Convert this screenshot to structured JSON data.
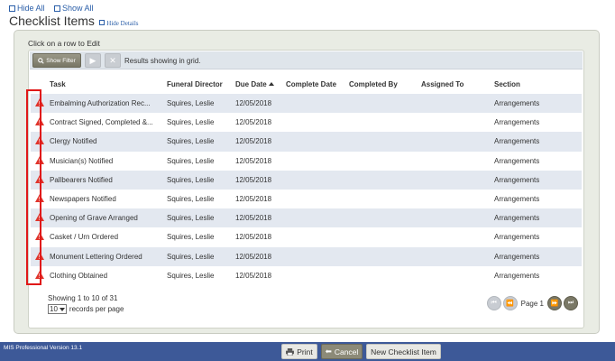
{
  "top_links": {
    "hide_all": "Hide All",
    "show_all": "Show All"
  },
  "header": {
    "title": "Checklist Items",
    "hide_details": "Hide Details"
  },
  "instruction": "Click on a row to Edit",
  "toolbar": {
    "show_filter": "Show Filter",
    "info": "Results showing in grid."
  },
  "columns": {
    "task": "Task",
    "director": "Funeral Director",
    "due": "Due Date",
    "complete": "Complete Date",
    "completed_by": "Completed By",
    "assigned": "Assigned To",
    "section": "Section"
  },
  "rows": [
    {
      "task": "Embalming Authorization Rec...",
      "director": "Squires, Leslie",
      "due": "12/05/2018",
      "section": "Arrangements"
    },
    {
      "task": "Contract Signed, Completed &...",
      "director": "Squires, Leslie",
      "due": "12/05/2018",
      "section": "Arrangements"
    },
    {
      "task": "Clergy Notified",
      "director": "Squires, Leslie",
      "due": "12/05/2018",
      "section": "Arrangements"
    },
    {
      "task": "Musician(s) Notified",
      "director": "Squires, Leslie",
      "due": "12/05/2018",
      "section": "Arrangements"
    },
    {
      "task": "Pallbearers Notified",
      "director": "Squires, Leslie",
      "due": "12/05/2018",
      "section": "Arrangements"
    },
    {
      "task": "Newspapers Notified",
      "director": "Squires, Leslie",
      "due": "12/05/2018",
      "section": "Arrangements"
    },
    {
      "task": "Opening of Grave Arranged",
      "director": "Squires, Leslie",
      "due": "12/05/2018",
      "section": "Arrangements"
    },
    {
      "task": "Casket / Urn Ordered",
      "director": "Squires, Leslie",
      "due": "12/05/2018",
      "section": "Arrangements"
    },
    {
      "task": "Monument Lettering Ordered",
      "director": "Squires, Leslie",
      "due": "12/05/2018",
      "section": "Arrangements"
    },
    {
      "task": "Clothing Obtained",
      "director": "Squires, Leslie",
      "due": "12/05/2018",
      "section": "Arrangements"
    }
  ],
  "footer": {
    "showing": "Showing 1 to 10 of 31",
    "per_page_value": "10",
    "per_page_label": "records per page",
    "page_label": "Page 1"
  },
  "bottom": {
    "version": "MIS Professional Version 13.1",
    "print": "Print",
    "cancel": "Cancel",
    "new_item": "New Checklist Item"
  },
  "colors": {
    "warning": "#e0332a",
    "highlight_box": "#e01818",
    "bottom_bar": "#3d5998",
    "row_alt": "#e3e8f0"
  }
}
